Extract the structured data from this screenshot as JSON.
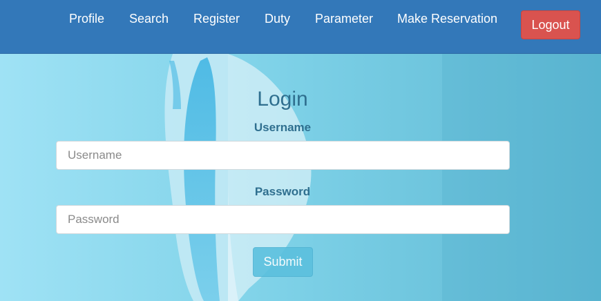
{
  "nav": {
    "items": [
      {
        "label": "Profile"
      },
      {
        "label": "Search"
      },
      {
        "label": "Register"
      },
      {
        "label": "Duty"
      },
      {
        "label": "Parameter"
      },
      {
        "label": "Make Reservation"
      }
    ],
    "logout_label": "Logout"
  },
  "login": {
    "title": "Login",
    "username_label": "Username",
    "username_placeholder": "Username",
    "username_value": "",
    "password_label": "Password",
    "password_placeholder": "Password",
    "password_value": "",
    "submit_label": "Submit"
  },
  "colors": {
    "navbar": "#3378b9",
    "logout": "#d9534f",
    "submit": "#5bc0de",
    "heading": "#2f6f8f"
  }
}
